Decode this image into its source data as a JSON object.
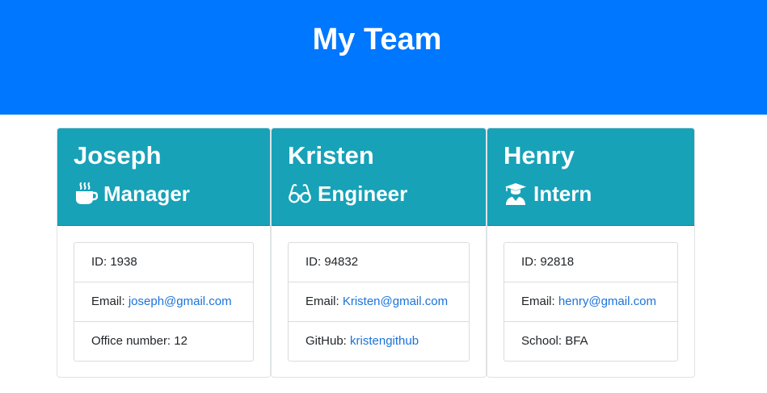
{
  "header": {
    "title": "My Team"
  },
  "colors": {
    "header_bg": "#0077ff",
    "card_head_bg": "#17a2b8",
    "link": "#1a73d9"
  },
  "cards": [
    {
      "name": "Joseph",
      "role": "Manager",
      "icon": "mug-hot-icon",
      "id_label": "ID: ",
      "id": "1938",
      "email_label": "Email: ",
      "email": "joseph@gmail.com",
      "extra_label": "Office number: ",
      "extra": "12"
    },
    {
      "name": "Kristen",
      "role": "Engineer",
      "icon": "glasses-icon",
      "id_label": "ID: ",
      "id": "94832",
      "email_label": "Email: ",
      "email": "Kristen@gmail.com",
      "extra_label": "GitHub: ",
      "extra": "kristengithub"
    },
    {
      "name": "Henry",
      "role": "Intern",
      "icon": "graduate-icon",
      "id_label": "ID: ",
      "id": "92818",
      "email_label": "Email: ",
      "email": "henry@gmail.com",
      "extra_label": "School: ",
      "extra": "BFA"
    }
  ]
}
